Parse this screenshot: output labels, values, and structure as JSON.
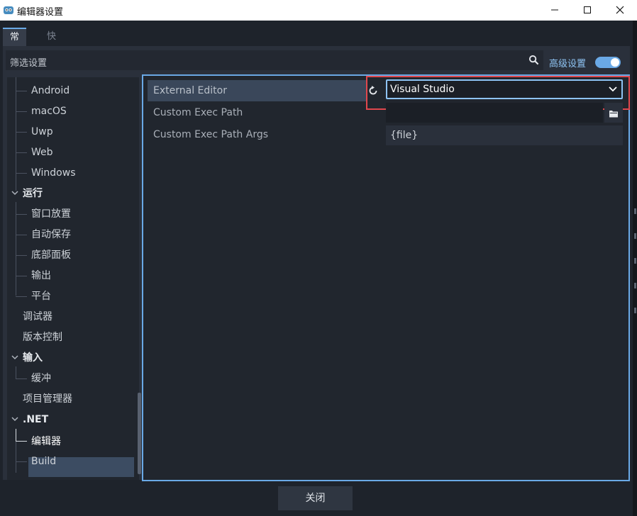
{
  "window": {
    "title": "编辑器设置"
  },
  "tabs": [
    {
      "label": "常规",
      "active": true
    },
    {
      "label": "快捷键",
      "active": false
    }
  ],
  "filter": {
    "placeholder": "筛选设置"
  },
  "advanced": {
    "label": "高级设置",
    "enabled": true
  },
  "tree": {
    "items": [
      {
        "label": "Android"
      },
      {
        "label": "macOS"
      },
      {
        "label": "Uwp"
      },
      {
        "label": "Web"
      },
      {
        "label": "Windows"
      },
      {
        "label": "运行"
      },
      {
        "label": "窗口放置"
      },
      {
        "label": "自动保存"
      },
      {
        "label": "底部面板"
      },
      {
        "label": "输出"
      },
      {
        "label": "平台"
      },
      {
        "label": "调试器"
      },
      {
        "label": "版本控制"
      },
      {
        "label": "输入"
      },
      {
        "label": "缓冲"
      },
      {
        "label": "项目管理器"
      },
      {
        "label": ".NET"
      },
      {
        "label": "编辑器"
      },
      {
        "label": "Build"
      }
    ],
    "selected": "编辑器"
  },
  "inspector": {
    "properties": [
      {
        "label": "External Editor"
      },
      {
        "label": "Custom Exec Path"
      },
      {
        "label": "Custom Exec Path Args"
      }
    ],
    "external_editor_value": "Visual Studio",
    "custom_exec_path_value": "",
    "custom_exec_path_args_value": "{file}"
  },
  "footer": {
    "close_label": "关闭"
  },
  "colors": {
    "accent": "#6aa9e6",
    "highlight_border": "#e0474d",
    "selected_bg": "#3c4c62"
  }
}
